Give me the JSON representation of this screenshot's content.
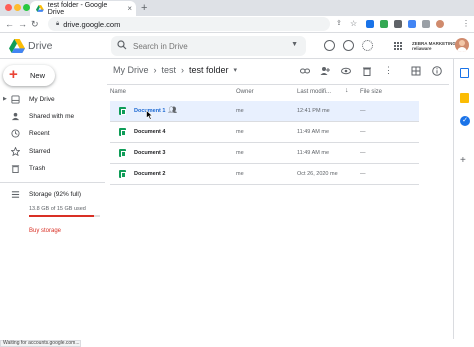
{
  "browser": {
    "tab_title": "test folder - Google Drive",
    "new_tab": "+",
    "url": "drive.google.com"
  },
  "header": {
    "app_name": "Drive",
    "search_placeholder": "Search in Drive",
    "brand": "ZEBRA MARKETING | reliaware"
  },
  "sidebar": {
    "new_label": "New",
    "items": [
      {
        "label": "My Drive",
        "icon": "drive-icon"
      },
      {
        "label": "Shared with me",
        "icon": "people-icon"
      },
      {
        "label": "Recent",
        "icon": "clock-icon"
      },
      {
        "label": "Starred",
        "icon": "star-icon"
      },
      {
        "label": "Trash",
        "icon": "trash-icon"
      }
    ],
    "storage_label": "Storage (92% full)",
    "storage_used": "13.8 GB of 15 GB used",
    "storage_fraction": 0.92,
    "buy_storage": "Buy storage"
  },
  "main": {
    "breadcrumb": [
      "My Drive",
      "test",
      "test folder"
    ],
    "columns": {
      "name": "Name",
      "owner": "Owner",
      "modified": "Last modifi...",
      "size": "File size"
    },
    "rows": [
      {
        "name": "Document 1",
        "owner": "me",
        "modified": "12:41 PM me",
        "size": "—"
      },
      {
        "name": "Document 4",
        "owner": "me",
        "modified": "11:49 AM me",
        "size": "—"
      },
      {
        "name": "Document 3",
        "owner": "me",
        "modified": "11:49 AM me",
        "size": "—"
      },
      {
        "name": "Document 2",
        "owner": "me",
        "modified": "Oct 26, 2020 me",
        "size": "—"
      }
    ]
  },
  "status_bar": "Waiting for accounts.google.com...",
  "colors": {
    "accent": "#1a73e8",
    "selected_row": "#e8f0fe",
    "sheets_green": "#0f9d58",
    "storage_red": "#d93025"
  }
}
